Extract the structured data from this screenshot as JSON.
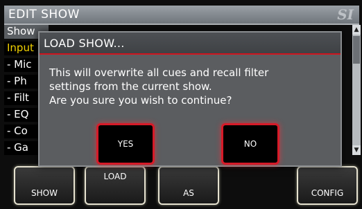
{
  "window": {
    "title": "EDIT SHOW",
    "logo": "SI"
  },
  "list": {
    "rows": [
      {
        "label": "Show"
      },
      {
        "label": "Input"
      },
      {
        "label": "- Mic"
      },
      {
        "label": "- Ph"
      },
      {
        "label": "- Filt"
      },
      {
        "label": "- EQ"
      },
      {
        "label": "- Co"
      },
      {
        "label": "- Ga"
      }
    ]
  },
  "softkeys": {
    "key1": "SHOW",
    "key2": "LOAD",
    "key3": "AS",
    "key4": "CONFIG"
  },
  "dialog": {
    "title": "LOAD SHOW...",
    "message_lines": [
      "This will overwrite all cues and recall filter",
      "settings from the current show.",
      "Are you sure you wish to continue?"
    ],
    "yes_label": "YES",
    "no_label": "NO"
  },
  "colors": {
    "accent": "#d71a28",
    "highlight_text": "#f2d200"
  }
}
